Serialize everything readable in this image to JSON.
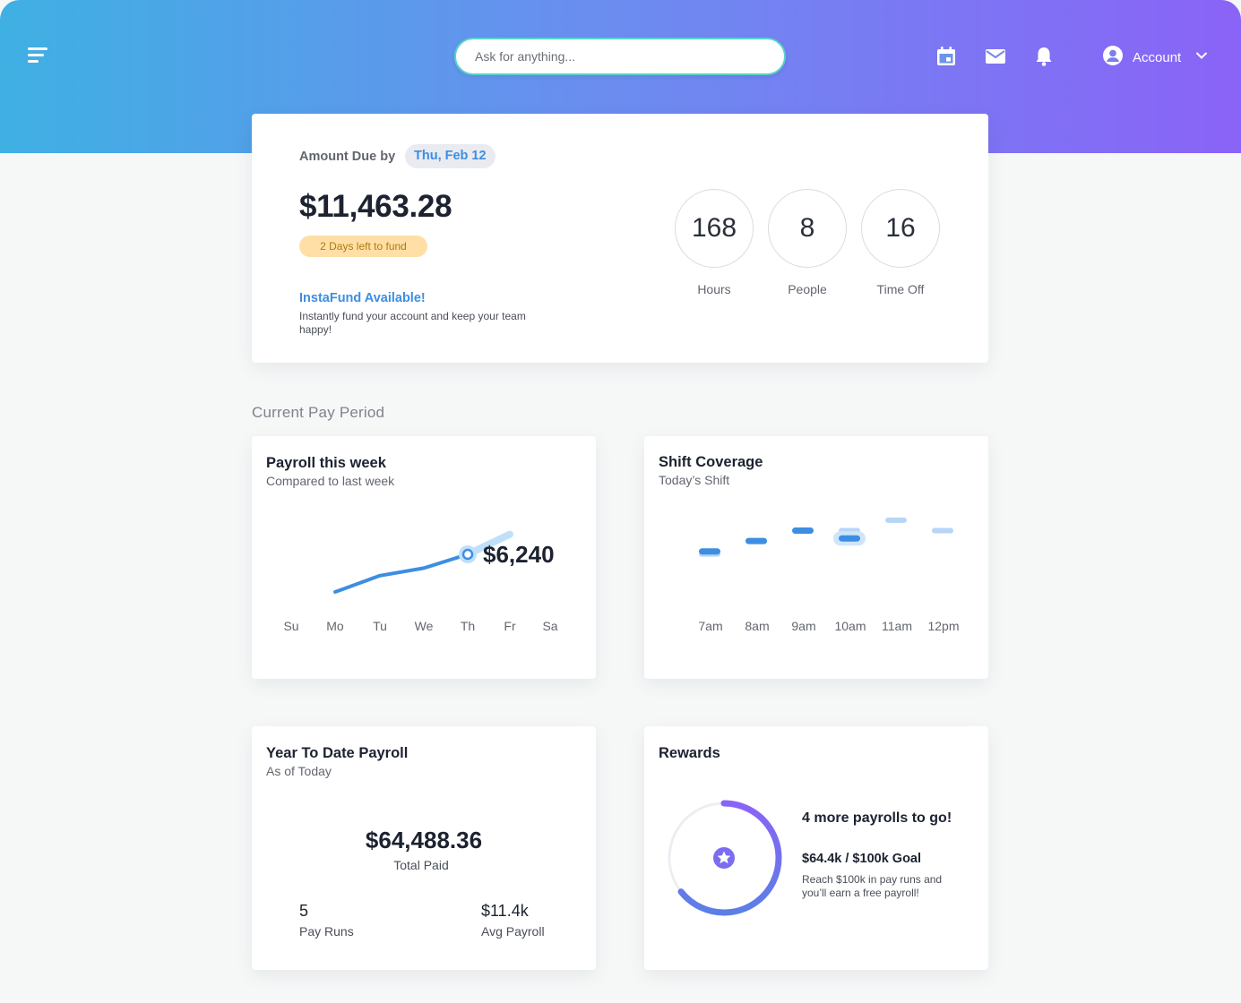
{
  "header": {
    "search": {
      "placeholder": "Ask for anything..."
    },
    "icons": [
      "menu-icon",
      "calendar-icon",
      "mail-icon",
      "bell-icon",
      "user-icon",
      "chevron-down-icon"
    ],
    "account_label": "Account"
  },
  "colors": {
    "gradient_start": "#3fb0e3",
    "gradient_end": "#8a63f7",
    "accent_blue": "#3d8ee2",
    "accent_teal": "#58d3c9",
    "warning_pill": "#ffdfa6",
    "rewards_purple": "#8a63f7"
  },
  "due": {
    "label": "Amount Due by",
    "date": "Thu, Feb 12",
    "amount": "$11,463.28",
    "days_left": "2 Days left to fund",
    "instafund_title": "InstaFund Available!",
    "instafund_desc": "Instantly fund your account and keep your team happy!",
    "stats": [
      {
        "value": "168",
        "label": "Hours"
      },
      {
        "value": "8",
        "label": "People"
      },
      {
        "value": "16",
        "label": "Time Off"
      }
    ]
  },
  "section_title": "Current Pay Period",
  "payroll": {
    "title": "Payroll this week",
    "subtitle": "Compared to last week",
    "value_label": "$6,240"
  },
  "shift": {
    "title": "Shift Coverage",
    "subtitle": "Today’s Shift"
  },
  "ytd": {
    "title": "Year To Date Payroll",
    "subtitle": "As of Today",
    "amount": "$64,488.36",
    "amount_label": "Total Paid",
    "pay_runs_value": "5",
    "pay_runs_label": "Pay Runs",
    "avg_value": "$11.4k",
    "avg_label": "Avg Payroll"
  },
  "rewards": {
    "title": "Rewards",
    "headline": "4 more payrolls to go!",
    "goal": "$64.4k / $100k Goal",
    "desc": "Reach $100k in pay runs and you’ll earn a free payroll!",
    "progress": 0.644,
    "icon": "star-icon"
  },
  "chart_data": [
    {
      "type": "line",
      "categories": [
        "Su",
        "Mo",
        "Tu",
        "We",
        "Th",
        "Fr",
        "Sa"
      ],
      "series": [
        {
          "values": [
            null,
            1.0,
            2.3,
            2.9,
            4.0,
            null,
            null
          ]
        },
        {
          "values": [
            null,
            null,
            null,
            null,
            4.0,
            5.6,
            null
          ]
        }
      ],
      "ylim": [
        0,
        7
      ],
      "annotations": [
        "$6,240"
      ]
    },
    {
      "type": "scatter",
      "categories": [
        "7am",
        "8am",
        "9am",
        "10am",
        "11am",
        "12pm"
      ],
      "series": [
        {
          "values": [
            2.7,
            3.1,
            3.5,
            3.2,
            null,
            null
          ]
        },
        {
          "values": [
            2.6,
            null,
            null,
            3.5,
            3.9,
            3.5
          ]
        }
      ],
      "ylim": [
        0,
        5
      ]
    }
  ]
}
